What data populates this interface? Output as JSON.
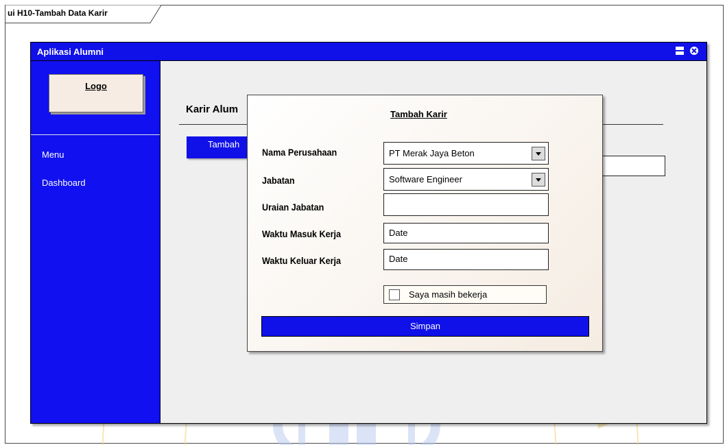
{
  "diagram": {
    "tab_label": "ui H10-Tambah Data Karir"
  },
  "window": {
    "title": "Aplikasi Alumni",
    "menu_icon": "menu-icon",
    "close_icon": "close-icon"
  },
  "sidebar": {
    "logo_label": "Logo",
    "items": [
      {
        "label": "Menu"
      },
      {
        "label": "Dashboard"
      }
    ]
  },
  "content": {
    "title": "Karir Alum",
    "add_button_label": "Tambah"
  },
  "dialog": {
    "title": "Tambah Karir",
    "fields": [
      {
        "label": "Nama Perusahaan",
        "value": "PT Merak Jaya Beton",
        "type": "dropdown"
      },
      {
        "label": "Jabatan",
        "value": "Software Engineer",
        "type": "dropdown"
      },
      {
        "label": "Uraian Jabatan",
        "value": "",
        "type": "text"
      },
      {
        "label": "Waktu Masuk Kerja",
        "value": "Date",
        "type": "date"
      },
      {
        "label": "Waktu Keluar Kerja",
        "value": "Date",
        "type": "date"
      }
    ],
    "checkbox_label": "Saya masih bekerja",
    "checkbox_checked": false,
    "submit_label": "Simpan"
  },
  "colors": {
    "window_blue": "#1010e8",
    "content_bg": "#efefef",
    "logo_bg": "#f6ece4",
    "watermark_gold": "#f2d27a"
  }
}
